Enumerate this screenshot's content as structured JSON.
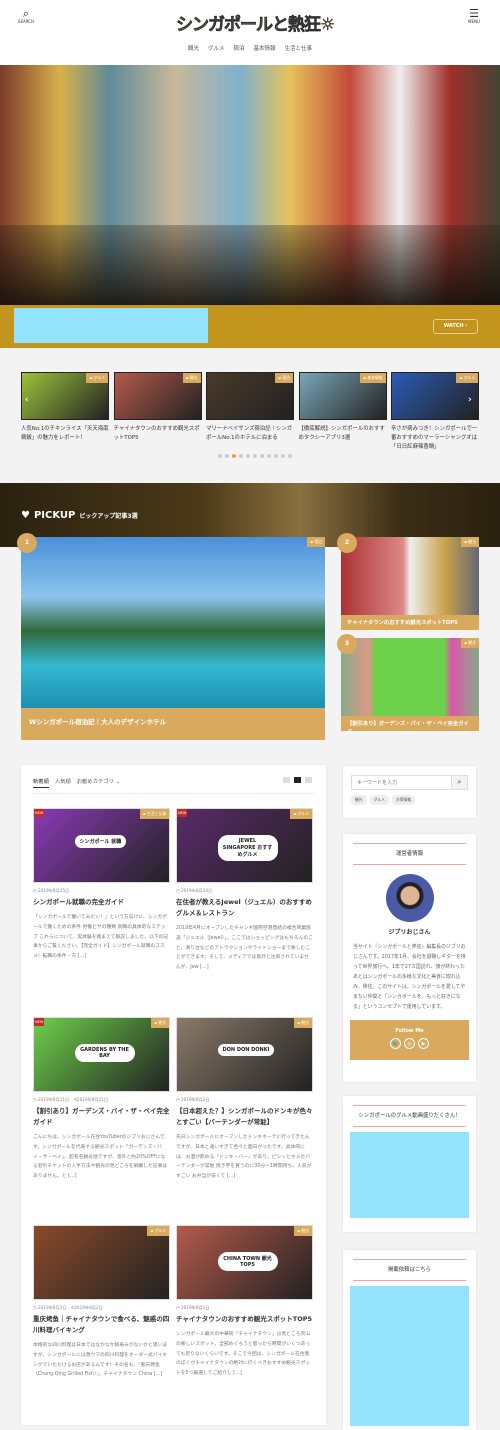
{
  "header": {
    "search_label": "SEARCH",
    "menu_label": "MENU",
    "logo": "シンガポールと熱狂",
    "logo_colors": [
      "#f4c81c",
      "#4ed1e6",
      "#ee7ed6",
      "#f0e050",
      "#9ad13a",
      "#f1663a"
    ],
    "nav": [
      "観光",
      "グルメ",
      "宿泊",
      "基本情報",
      "生活と仕事"
    ]
  },
  "hero": {
    "watch_label": "WATCH",
    "bar_color": "#c4951d",
    "ad_color": "#93e3fd"
  },
  "carousel": {
    "items": [
      {
        "cat": "グルメ",
        "title": "人気No.1のチキンライス「天天海南鶏飯」の魅力をレポート！",
        "c": "#9cc23a"
      },
      {
        "cat": "観光",
        "title": "チャイナタウンのおすすめ観光スポットTOP5",
        "c": "#b45a4a"
      },
      {
        "cat": "宿泊",
        "title": "マリーナベイサンズ宿泊記｜シンガポールNo.1のホテルに泊まる",
        "c": "#4a3a2a"
      },
      {
        "cat": "基本情報",
        "title": "【徹底解説】シンガポールのおすすめタクシーアプリ3選",
        "c": "#7aa6b8"
      },
      {
        "cat": "グルメ",
        "title": "辛さが病みつき！シンガポールで一番おすすめのマーラーシャングオは「日日紅麻辣香鍋」",
        "c": "#2b5bb5"
      }
    ],
    "active_dot": 3,
    "dot_count": 11
  },
  "pickup": {
    "title": "PICKUP",
    "subtitle": "ピックアップ記事3選",
    "items": [
      {
        "rank": "1",
        "cat": "宿泊",
        "title": "Wシンガポール宿泊記｜大人のデザインホテル"
      },
      {
        "rank": "2",
        "cat": "観光",
        "title": "チャイナタウンのおすすめ観光スポットTOP5"
      },
      {
        "rank": "3",
        "cat": "観光",
        "title": "【割引あり】ガーデンズ・バイ・ザ・ベイ完全ガイド"
      }
    ]
  },
  "main": {
    "tabs": [
      "新着順",
      "人気順",
      "お勧めカテゴリ ⌄"
    ],
    "articles": [
      {
        "new": "NEW",
        "cat": "生活と仕事",
        "date": "2019年8月25日",
        "title": "シンガポール就職の完全ガイド",
        "excerpt": "「シンガポールで働いてみたい！」という方向けに、シンガポールで働くための条件 労働ビザの種類 就職の具体的なステップ これらについて、実体験を踏まえて解説しました。以下の記事からご覧ください。【完全ガイド】シンガポール就職のススメ！転職の条件・方 […]",
        "c": "#8a3ab5",
        "img": "シンガポール 就職"
      },
      {
        "new": "NEW",
        "cat": "グルメ",
        "date": "2019年8月24日",
        "title": "在住者が教えるJewel（ジュエル）のおすすめグルメ＆レストラン",
        "excerpt": "2019年4月にオープンしたチャンギ国際空港直結の複合商業施設「ジュエル（Jewel）」。ここではショッピングはもちろんのこと、滑り台などのアトラクションやライトショーまで楽しむことができます。そして、メディアでは意外と注目されていませんが、Jew […]",
        "c": "#5a2a6a",
        "img": "JEWEL SINGAPORE おすすめグルメ"
      },
      {
        "new": "NEW",
        "cat": "観光",
        "date": "2019年8月21日　⟲2019年8月21日",
        "title": "【割引あり】ガーデンズ・バイ・ザ・ベイ完全ガイド",
        "excerpt": "こんにちは、シンガポール在住YouTuberのジブリおじさんです。シンガポールを代表する観光スポット「ガーデンズ・バイ・ザ・ベイ」。超有名観光地ですが、意外と約20%OFFになる割引チケットの入手方法や観光の見どころを網羅した記事はありません。と […]",
        "c": "#6dd04a",
        "img": "GARDENS BY THE BAY"
      },
      {
        "new": "",
        "cat": "観光",
        "date": "2019年8月2日",
        "title": "【日本超えた？】シンガポールのドンキが色々とすごい【バーテンダーが常駐】",
        "excerpt": "先日シンガポールにオープンしたドンキホーテに行ってきたんですが、日本と違いすぎて色々と面白かったです。具体的には、お酒が飲める『ドンキ・バー』があり、ピシッとキメたバーテンダーが常駐 焼き芋を買うのに30分〜1時間待ち、人気がすごい お弁当が安くて […]",
        "c": "#8a7a6a",
        "img": "DON DON DONKI"
      },
      {
        "new": "",
        "cat": "グルメ",
        "date": "2019年8月2日　⟲2019年8月2日",
        "title": "重庆烤鱼｜チャイナタウンで食べる、魅惑の四川料理バイキング",
        "excerpt": "本格的な四川料理は日本ではなかなか馴染みがないかと思いますが、シンガポールには激ウマの四川料理をオーダー式バイキングでいただけるお店があるんです！その名も、『重庆烤鱼（Chong Qing Grilled Fish）』。チャイナタウン China […]",
        "c": "#8a4a2a",
        "img": ""
      },
      {
        "new": "",
        "cat": "観光",
        "date": "2019年8月1日",
        "title": "チャイナタウンのおすすめ観光スポットTOP5",
        "excerpt": "シンガポール最大の中華街「チャイナタウン」は見どころ沢山の楽しいスポット。全部めぐろうと思ったら時間がいくつあっても足りないくらいです。そこで今回は、シンガポール在住者のぼくがチャイナタウンの絶対に行くべきおすすめ観光スポットを5つ厳選してご紹介し […]",
        "c": "#b45a4a",
        "img": "CHINA TOWN 観光TOP5"
      }
    ]
  },
  "sidebar": {
    "search_placeholder": "キーワードを入力",
    "tags": [
      "観光",
      "グルメ",
      "お得情報"
    ],
    "profile": {
      "title": "運営者情報",
      "name": "ジブリおじさん",
      "bio": "当サイト『シンガポールと熱狂』編集長のジブリおじさんです。2017年1月、会社を退職しギターを持って世界旅行へ。1年で27カ国訪れ、旅が終わったあとはシンガポールの多様な文化と美食に惚れ込み、移住。このサイトは、シンガポールを愛してやまない仲間と「シンガポールを、もっと好きになる」というコンセプトで運用しています。",
      "follow": "Follow Me",
      "social": [
        "twitter-icon",
        "instagram-icon",
        "youtube-icon"
      ]
    },
    "video_title": "シンガポールのグルメ動画盛りだくさん！",
    "request_title": "掲載依頼はこちら"
  },
  "colors": {
    "accent": "#d9aa5e",
    "new_badge": "#c52a2a"
  }
}
